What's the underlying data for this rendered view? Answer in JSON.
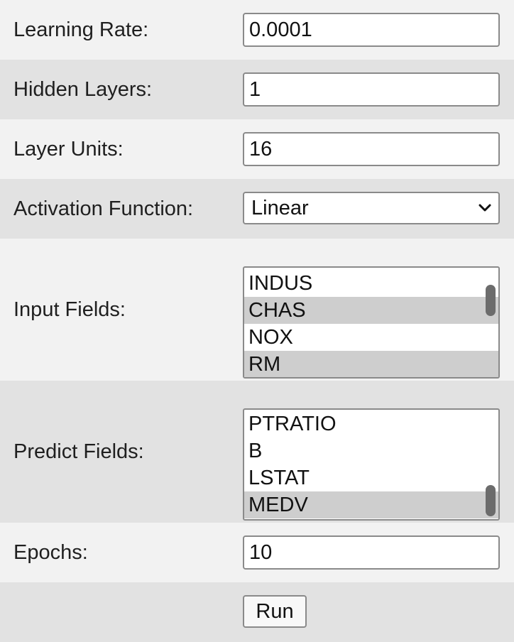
{
  "form": {
    "learning_rate": {
      "label": "Learning Rate:",
      "value": "0.0001"
    },
    "hidden_layers": {
      "label": "Hidden Layers:",
      "value": "1"
    },
    "layer_units": {
      "label": "Layer Units:",
      "value": "16"
    },
    "activation": {
      "label": "Activation Function:",
      "selected": "Linear",
      "icon": "chevron-down-icon"
    },
    "input_fields": {
      "label": "Input Fields:",
      "options": [
        {
          "label": "INDUS",
          "selected": false
        },
        {
          "label": "CHAS",
          "selected": true
        },
        {
          "label": "NOX",
          "selected": false
        },
        {
          "label": "RM",
          "selected": true
        }
      ]
    },
    "predict_fields": {
      "label": "Predict Fields:",
      "options": [
        {
          "label": "PTRATIO",
          "selected": false
        },
        {
          "label": "B",
          "selected": false
        },
        {
          "label": "LSTAT",
          "selected": false
        },
        {
          "label": "MEDV",
          "selected": true
        }
      ]
    },
    "epochs": {
      "label": "Epochs:",
      "value": "10"
    },
    "run_button": {
      "label": "Run"
    }
  },
  "colors": {
    "row_light": "#f2f2f2",
    "row_dark": "#e2e2e2",
    "selected_option": "#cecece",
    "scroll_thumb": "#6c6c6c"
  }
}
